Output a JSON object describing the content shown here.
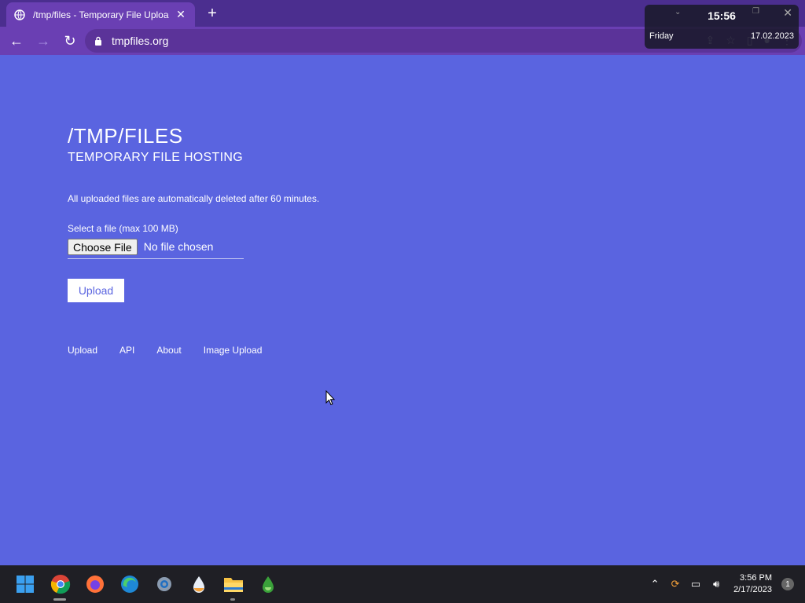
{
  "browser": {
    "tab_title": "/tmp/files - Temporary File Uploa",
    "url": "tmpfiles.org"
  },
  "clock_widget": {
    "time": "15:56",
    "day": "Friday",
    "date": "17.02.2023"
  },
  "page": {
    "title": "/TMP/FILES",
    "subtitle": "TEMPORARY FILE HOSTING",
    "notice": "All uploaded files are automatically deleted after 60 minutes.",
    "file_label": "Select a file (max 100 MB)",
    "choose_button": "Choose File",
    "no_file": "No file chosen",
    "upload_button": "Upload",
    "links": [
      "Upload",
      "API",
      "About",
      "Image Upload"
    ]
  },
  "taskbar": {
    "time": "3:56 PM",
    "date": "2/17/2023",
    "notification_count": "1"
  },
  "colors": {
    "page_bg": "#5a64e0",
    "tab_bar": "#4b2e8f",
    "toolbar": "#6a3fb3",
    "taskbar": "#1f1f25"
  }
}
